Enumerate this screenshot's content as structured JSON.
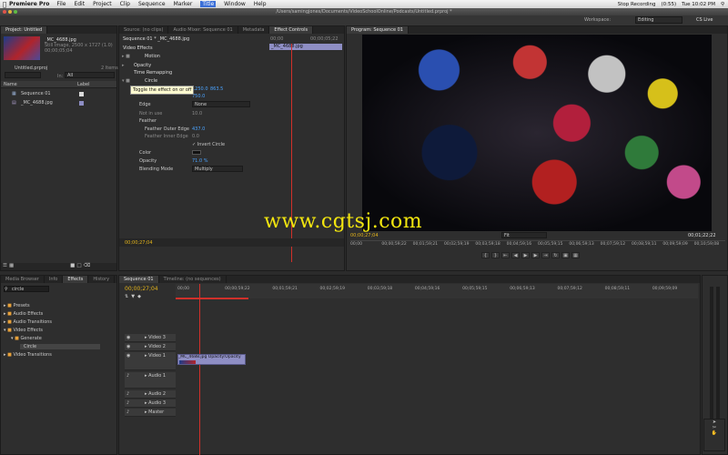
{
  "menubar": {
    "app_name": "Premiere Pro",
    "items": [
      "File",
      "Edit",
      "Project",
      "Clip",
      "Sequence",
      "Marker",
      "Title",
      "Window",
      "Help"
    ],
    "active_item": "Title",
    "stop_recording": "Stop Recording",
    "battery": "(0:55)",
    "clock": "Tue 10:02 PM"
  },
  "titlebar": {
    "path": "/Users/samingjones/Documents/VideoSchoolOnline/Podcasts/Untitled.prproj *"
  },
  "workspace": {
    "label": "Workspace:",
    "value": "Editing",
    "cs_live": "CS Live"
  },
  "project": {
    "tab": "Project: Untitled",
    "clip_name": "_MC_4688.jpg",
    "clip_type": "Still Image, 2500 x 1727 (1.0)",
    "clip_duration": "00;00;05;04",
    "project_file": "Untitled.prproj",
    "items_count": "2 Items",
    "in_label": "In:",
    "in_value": "All",
    "col_name": "Name",
    "col_label": "Label",
    "items": [
      "Sequence 01",
      "_MC_4688.jpg"
    ]
  },
  "effect_controls": {
    "tabs": [
      "Source: (no clips)",
      "Audio Mixer: Sequence 01",
      "Metadata",
      "Effect Controls"
    ],
    "active_tab": "Effect Controls",
    "header": "Sequence 01 * _MC_4688.jpg",
    "header_time": "00;00",
    "header_time2": "00;00;05;22",
    "clip_label": "_MC_4688.jpg",
    "video_effects": "Video Effects",
    "motion": "Motion",
    "opacity": "Opacity",
    "time_remapping": "Time Remapping",
    "circle": "Circle",
    "tooltip": "Toggle the effect on or off",
    "center_x": "1250.0",
    "center_y": "863.5",
    "radius_value": "750.0",
    "edge_label": "Edge",
    "edge_value": "None",
    "not_in_use": "Not in use",
    "not_in_use_value": "10.0",
    "feather": "Feather",
    "feather_outer_label": "Feather Outer Edge",
    "feather_outer_value": "437.0",
    "feather_inner_label": "Feather Inner Edge",
    "feather_inner_value": "0.0",
    "invert_circle": "Invert Circle",
    "color_label": "Color",
    "opacity_label": "Opacity",
    "opacity_value": "71.0 %",
    "blending_label": "Blending Mode",
    "blending_value": "Multiply",
    "footer_time": "00;00;27;04"
  },
  "program": {
    "tab": "Program: Sequence 01",
    "timecode_current": "00;00;27;04",
    "fit_value": "Fit",
    "timecode_duration": "00;01;22;22",
    "ruler": [
      "00;00",
      "00;00;59;22",
      "00;01;59;21",
      "00;02;59;19",
      "00;03;59;18",
      "00;04;59;16",
      "00;05;59;15",
      "00;06;59;13",
      "00;07;59;12",
      "00;08;59;11",
      "00;09;59;09",
      "00;10;59;08"
    ]
  },
  "watermark": "www.cgtsj.com",
  "effects_panel": {
    "tabs": [
      "Media Browser",
      "Info",
      "Effects",
      "History"
    ],
    "active_tab": "Effects",
    "search_value": "circle",
    "tree": [
      "Presets",
      "Audio Effects",
      "Audio Transitions",
      "Video Effects",
      "Generate",
      "Circle",
      "Video Transitions"
    ]
  },
  "timeline": {
    "tabs": [
      "Sequence 01",
      "Timeline: (no sequences)"
    ],
    "timecode": "00;00;27;04",
    "ruler": [
      "00;00",
      "00;00;59;22",
      "00;01;59;21",
      "00;02;59;19",
      "00;03;59;18",
      "00;04;59;16",
      "00;05;59;15",
      "00;06;59;13",
      "00;07;59;12",
      "00;08;59;11",
      "00;09;59;09"
    ],
    "tracks": [
      "Video 3",
      "Video 2",
      "Video 1",
      "Audio 1",
      "Audio 2",
      "Audio 3",
      "Master"
    ],
    "clip_label": "_MC_4688.jpg Opacity:Opacity"
  },
  "colors": {
    "accent_blue": "#4aa3ff",
    "timecode_yellow": "#e5b51a",
    "clip_purple": "#8e8ec4",
    "playhead_red": "#d0302a",
    "watermark_yellow": "#f3e60f"
  },
  "icons": [
    "apple-icon",
    "folder-icon",
    "sequence-icon",
    "image-icon",
    "play-icon",
    "step-back-icon",
    "step-forward-icon",
    "eye-icon",
    "speaker-icon",
    "lock-icon",
    "search-icon",
    "wrench-icon"
  ]
}
